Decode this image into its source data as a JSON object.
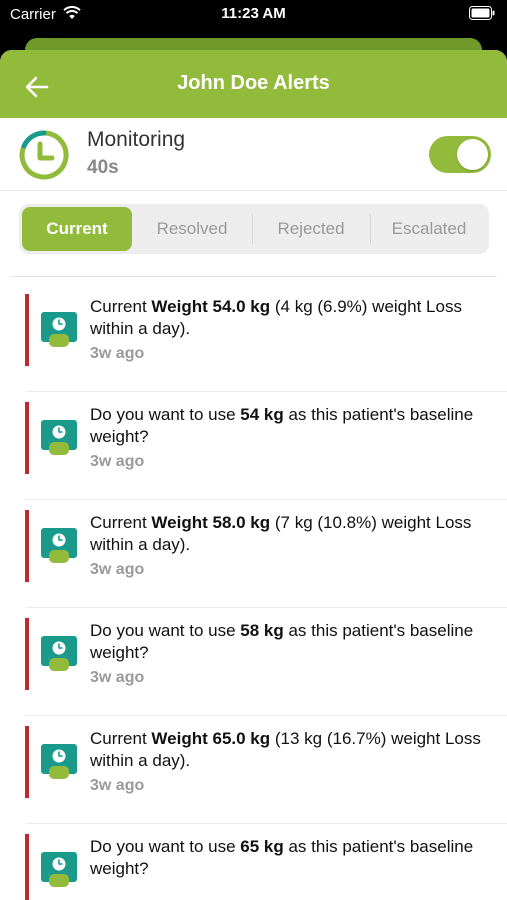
{
  "status_bar": {
    "carrier": "Carrier",
    "time": "11:23 AM",
    "wifi_icon": "wifi-icon",
    "battery_icon": "battery-icon"
  },
  "header": {
    "title": "John Doe Alerts",
    "back_icon": "arrow-left-icon"
  },
  "monitoring": {
    "title": "Monitoring",
    "subtitle": "40s",
    "icon": "clock-icon",
    "enabled": true
  },
  "tabs": [
    {
      "label": "Current",
      "active": true
    },
    {
      "label": "Resolved",
      "active": false
    },
    {
      "label": "Rejected",
      "active": false
    },
    {
      "label": "Escalated",
      "active": false
    }
  ],
  "alerts": [
    {
      "pre": "Current ",
      "bold": "Weight 54.0 kg",
      "post": " (4 kg (6.9%) weight Loss within a day).",
      "time": "3w ago"
    },
    {
      "pre": "Do you want to use ",
      "bold": "54 kg",
      "post": " as this patient's baseline weight?",
      "time": "3w ago"
    },
    {
      "pre": "Current ",
      "bold": "Weight 58.0 kg",
      "post": " (7 kg (10.8%) weight Loss within a day).",
      "time": "3w ago"
    },
    {
      "pre": "Do you want to use ",
      "bold": "58 kg",
      "post": " as this patient's baseline weight?",
      "time": "3w ago"
    },
    {
      "pre": "Current ",
      "bold": "Weight 65.0 kg",
      "post": " (13 kg (16.7%) weight Loss within a day).",
      "time": "3w ago"
    },
    {
      "pre": "Do you want to use ",
      "bold": "65 kg",
      "post": " as this patient's baseline weight?",
      "time": ""
    }
  ],
  "colors": {
    "accent": "#92bb3b",
    "alert_bar": "#c1272d",
    "alert_icon": "#1a9a8a"
  },
  "alert_icon": "weight-scale-icon"
}
